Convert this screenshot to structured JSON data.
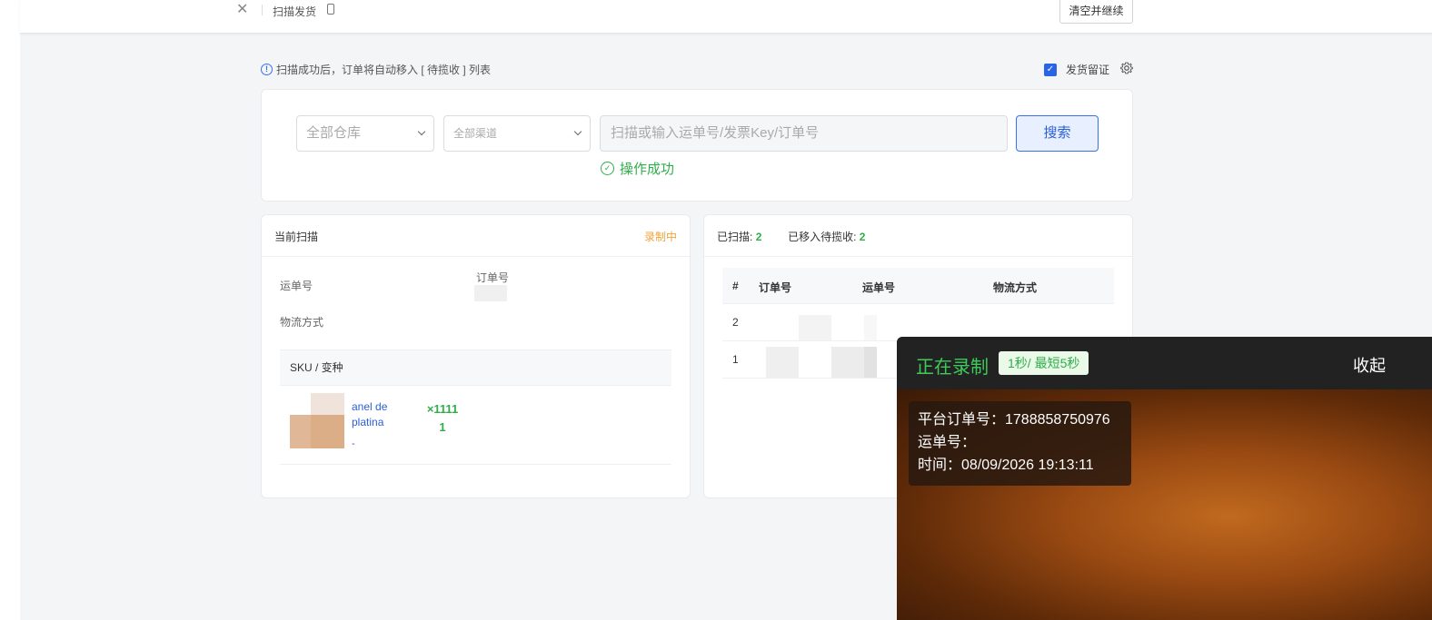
{
  "topbar": {
    "close_icon": "close-icon",
    "title": "扫描发货",
    "device_icon": "phone-icon",
    "clear_button": "清空并继续"
  },
  "hint": {
    "icon": "info-icon",
    "text": "扫描成功后，订单将自动移入 [ 待揽收 ] 列表"
  },
  "keep_evidence": {
    "checked": true,
    "label": "发货留证",
    "settings_icon": "gear-icon"
  },
  "search": {
    "warehouse_select": "全部仓库",
    "channel_select": "全部渠道",
    "input_placeholder": "扫描或输入运单号/发票Key/订单号",
    "input_value": "",
    "button": "搜索",
    "success_message": "操作成功"
  },
  "current_scan": {
    "title": "当前扫描",
    "status": "录制中",
    "tracking_label": "运单号",
    "order_label": "订单号",
    "logistics_label": "物流方式",
    "sku_header": "SKU / 变种",
    "sku_items": [
      {
        "name": "anel de platina",
        "variant": "-",
        "quantity": "×1111\n1"
      }
    ]
  },
  "scan_list": {
    "scanned_label": "已扫描:",
    "scanned_count": "2",
    "moved_label": "已移入待揽收:",
    "moved_count": "2",
    "columns": [
      "#",
      "订单号",
      "运单号",
      "物流方式"
    ],
    "rows": [
      {
        "index": "2"
      },
      {
        "index": "1"
      }
    ]
  },
  "recording": {
    "title": "正在录制",
    "timer": "1秒/ 最短5秒",
    "collapse": "收起",
    "overlay": {
      "order": "平台订单号：1788858750976",
      "tracking": "运单号：",
      "time": "时间：08/09/2026 19:13:11"
    }
  },
  "colors": {
    "primary": "#2a64e6",
    "success": "#2fae4a",
    "recording": "#f0a33a"
  }
}
